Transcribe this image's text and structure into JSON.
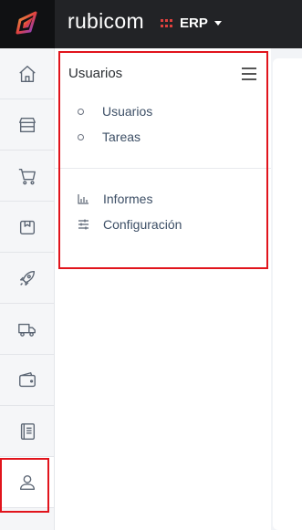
{
  "topbar": {
    "brand": "rubicom",
    "module_label": "ERP"
  },
  "rail": {
    "items": [
      {
        "name": "home-icon"
      },
      {
        "name": "store-icon"
      },
      {
        "name": "cart-icon"
      },
      {
        "name": "box-icon"
      },
      {
        "name": "rocket-icon"
      },
      {
        "name": "truck-icon"
      },
      {
        "name": "wallet-icon"
      },
      {
        "name": "book-icon"
      },
      {
        "name": "user-icon",
        "active": true
      }
    ]
  },
  "submenu": {
    "title": "Usuarios",
    "items": [
      {
        "label": "Usuarios"
      },
      {
        "label": "Tareas"
      }
    ],
    "tools": [
      {
        "label": "Informes",
        "icon": "bar-chart-icon"
      },
      {
        "label": "Configuración",
        "icon": "sliders-icon"
      }
    ]
  },
  "colors": {
    "topbar": "#222326",
    "accent": "#e0413e",
    "highlight": "#e1141c"
  }
}
